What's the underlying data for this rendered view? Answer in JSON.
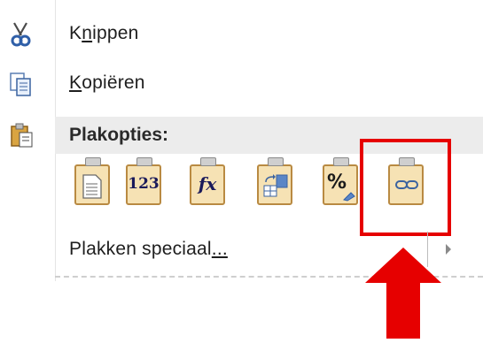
{
  "menu": {
    "cut": {
      "label_prefix": "K",
      "label_accel": "n",
      "label_suffix": "ippen",
      "icon": "scissors-icon"
    },
    "copy": {
      "label_accel": "K",
      "label_suffix": "opiëren",
      "icon": "copy-icon"
    },
    "paste_header": {
      "label": "Plakopties:",
      "icon": "clipboard-icon"
    },
    "paste_options": [
      {
        "name": "paste-keep-source",
        "glyph": "",
        "icon": "document-icon"
      },
      {
        "name": "paste-values",
        "glyph": "123",
        "icon": "values-icon"
      },
      {
        "name": "paste-formulas",
        "glyph": "fx",
        "icon": "formula-icon"
      },
      {
        "name": "paste-transpose",
        "glyph": "",
        "icon": "transpose-icon"
      },
      {
        "name": "paste-formatting",
        "glyph": "%",
        "icon": "formatting-icon"
      },
      {
        "name": "paste-link",
        "glyph": "",
        "icon": "link-icon"
      }
    ],
    "paste_special": {
      "label_prefix": "Plakken speciaal",
      "label_accel": "...",
      "icon": "chevron-right-icon"
    }
  },
  "colors": {
    "highlight": "#e60000",
    "arrow": "#e60000",
    "clipboard_fill": "#f6e2b4",
    "clipboard_border": "#b98a42",
    "header_bg": "#ececec"
  }
}
